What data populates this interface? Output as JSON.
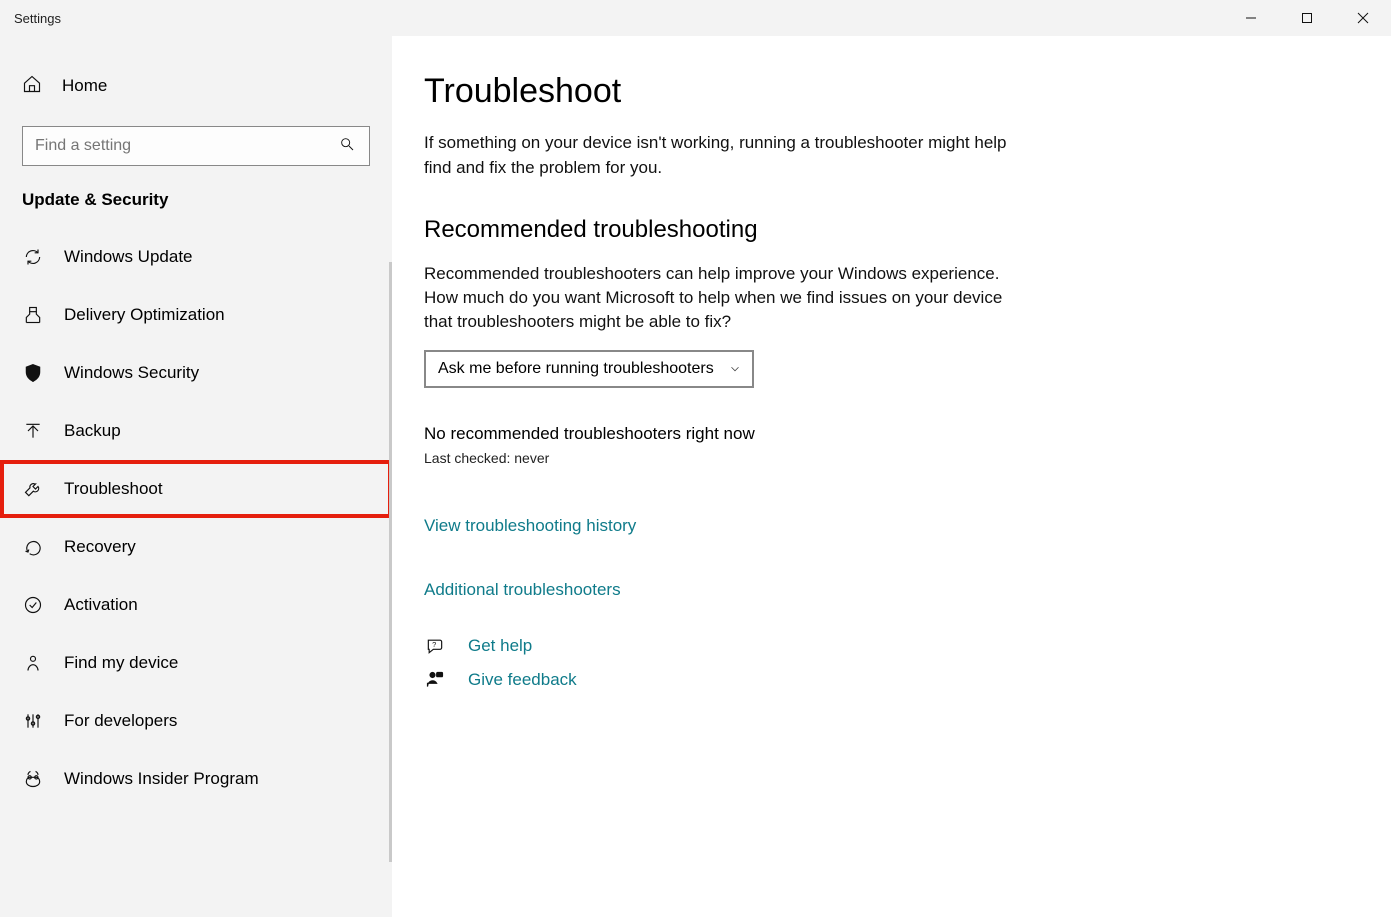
{
  "window": {
    "title": "Settings"
  },
  "sidebar": {
    "home": "Home",
    "search_placeholder": "Find a setting",
    "category": "Update & Security",
    "items": [
      {
        "label": "Windows Update"
      },
      {
        "label": "Delivery Optimization"
      },
      {
        "label": "Windows Security"
      },
      {
        "label": "Backup"
      },
      {
        "label": "Troubleshoot"
      },
      {
        "label": "Recovery"
      },
      {
        "label": "Activation"
      },
      {
        "label": "Find my device"
      },
      {
        "label": "For developers"
      },
      {
        "label": "Windows Insider Program"
      }
    ]
  },
  "main": {
    "title": "Troubleshoot",
    "intro": "If something on your device isn't working, running a troubleshooter might help find and fix the problem for you.",
    "section_heading": "Recommended troubleshooting",
    "section_para": "Recommended troubleshooters can help improve your Windows experience. How much do you want Microsoft to help when we find issues on your device that troubleshooters might be able to fix?",
    "dropdown_value": "Ask me before running troubleshooters",
    "no_rec": "No recommended troubleshooters right now",
    "last_checked": "Last checked: never",
    "link_history": "View troubleshooting history",
    "link_additional": "Additional troubleshooters",
    "link_help": "Get help",
    "link_feedback": "Give feedback"
  }
}
